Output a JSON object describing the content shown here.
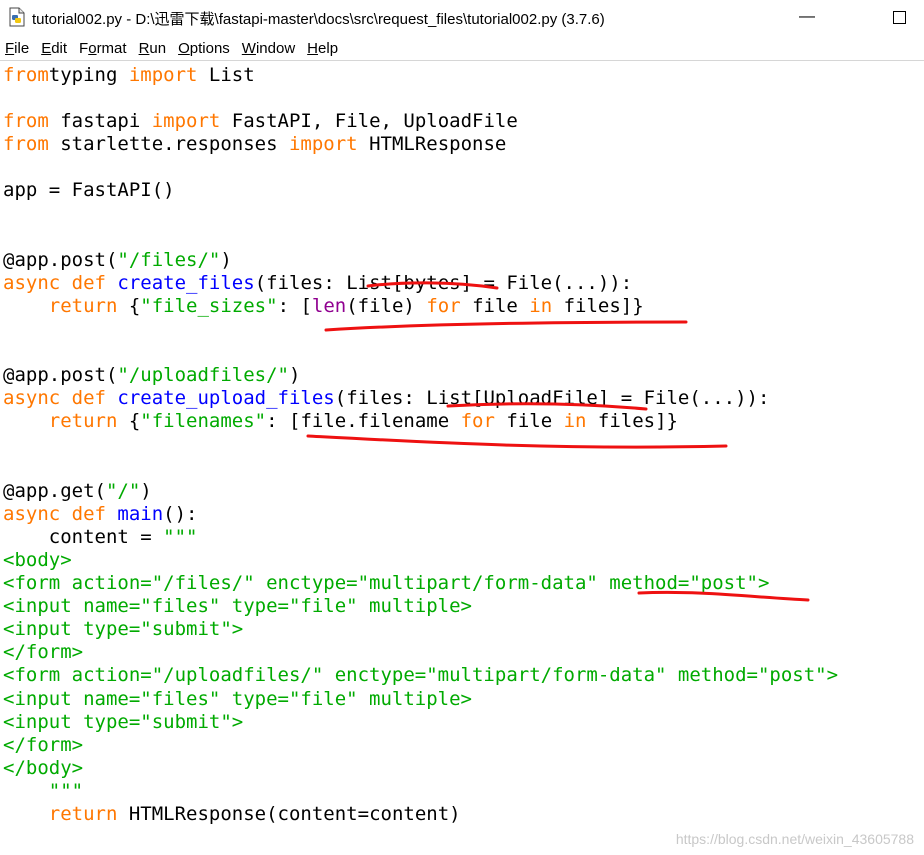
{
  "window": {
    "title": "tutorial002.py - D:\\迅雷下载\\fastapi-master\\docs\\src\\request_files\\tutorial002.py (3.7.6)",
    "minimize_glyph": "—",
    "maximize_glyph": "☐"
  },
  "menu": [
    {
      "mnemonic": "F",
      "rest": "ile"
    },
    {
      "mnemonic": "E",
      "rest": "dit"
    },
    {
      "mnemonic": "",
      "pre": "F",
      "mn": "o",
      "post": "rmat"
    },
    {
      "mnemonic": "R",
      "rest": "un"
    },
    {
      "mnemonic": "O",
      "rest": "ptions"
    },
    {
      "mnemonic": "W",
      "rest": "indow"
    },
    {
      "mnemonic": "H",
      "rest": "elp"
    }
  ],
  "colors": {
    "keyword": "#ff7700",
    "string": "#00aa00",
    "definition": "#0000ff",
    "builtin": "#900090",
    "annotation": "#ee0000"
  },
  "code_lines": [
    [
      [
        "kw",
        "from"
      ],
      [
        "",
        "typing "
      ],
      [
        "kw",
        "import"
      ],
      [
        "",
        " List"
      ]
    ],
    [],
    [
      [
        "kw",
        "from"
      ],
      [
        "",
        ""
      ],
      [
        "",
        " fastapi "
      ],
      [
        "kw",
        "import"
      ],
      [
        "",
        " FastAPI, File, UploadFile"
      ]
    ],
    [
      [
        "kw",
        "from"
      ],
      [
        "",
        " starlette.responses "
      ],
      [
        "kw",
        "import"
      ],
      [
        "",
        " HTMLResponse"
      ]
    ],
    [],
    [
      [
        "",
        "app = FastAPI()"
      ]
    ],
    [],
    [],
    [
      [
        "",
        "@app.post("
      ],
      [
        "str",
        "\"/files/\""
      ],
      [
        "",
        ")"
      ]
    ],
    [
      [
        "kw",
        "async def"
      ],
      [
        "",
        " "
      ],
      [
        "def",
        "create_files"
      ],
      [
        "",
        "(files: List[bytes] = File(...)):"
      ]
    ],
    [
      [
        "",
        "    "
      ],
      [
        "kw",
        "return"
      ],
      [
        "",
        " {"
      ],
      [
        "str",
        "\"file_sizes\""
      ],
      [
        "",
        ": ["
      ],
      [
        "bi",
        "len"
      ],
      [
        "",
        "(file) "
      ],
      [
        "kw",
        "for"
      ],
      [
        "",
        " file "
      ],
      [
        "kw",
        "in"
      ],
      [
        "",
        " files]}"
      ]
    ],
    [],
    [],
    [
      [
        "",
        "@app.post("
      ],
      [
        "str",
        "\"/uploadfiles/\""
      ],
      [
        "",
        ")"
      ]
    ],
    [
      [
        "kw",
        "async def"
      ],
      [
        "",
        " "
      ],
      [
        "def",
        "create_upload_files"
      ],
      [
        "",
        "(files: List[UploadFile] = File(...)):"
      ]
    ],
    [
      [
        "",
        "    "
      ],
      [
        "kw",
        "return"
      ],
      [
        "",
        " {"
      ],
      [
        "str",
        "\"filenames\""
      ],
      [
        "",
        ": [file.filename "
      ],
      [
        "kw",
        "for"
      ],
      [
        "",
        " file "
      ],
      [
        "kw",
        "in"
      ],
      [
        "",
        " files]}"
      ]
    ],
    [],
    [],
    [
      [
        "",
        "@app.get("
      ],
      [
        "str",
        "\"/\""
      ],
      [
        "",
        ")"
      ]
    ],
    [
      [
        "kw",
        "async def"
      ],
      [
        "",
        " "
      ],
      [
        "def",
        "main"
      ],
      [
        "",
        "():"
      ]
    ],
    [
      [
        "",
        "    content = "
      ],
      [
        "str",
        "\"\"\""
      ]
    ],
    [
      [
        "str",
        "<body>"
      ]
    ],
    [
      [
        "str",
        "<form action=\"/files/\" enctype=\"multipart/form-data\" method=\"post\">"
      ]
    ],
    [
      [
        "str",
        "<input name=\"files\" type=\"file\" multiple>"
      ]
    ],
    [
      [
        "str",
        "<input type=\"submit\">"
      ]
    ],
    [
      [
        "str",
        "</form>"
      ]
    ],
    [
      [
        "str",
        "<form action=\"/uploadfiles/\" enctype=\"multipart/form-data\" method=\"post\">"
      ]
    ],
    [
      [
        "str",
        "<input name=\"files\" type=\"file\" multiple>"
      ]
    ],
    [
      [
        "str",
        "<input type=\"submit\">"
      ]
    ],
    [
      [
        "str",
        "</form>"
      ]
    ],
    [
      [
        "str",
        "</body>"
      ]
    ],
    [
      [
        "str",
        "    \"\"\""
      ]
    ],
    [
      [
        "",
        "    "
      ],
      [
        "kw",
        "return"
      ],
      [
        "",
        " HTMLResponse(content=content)"
      ]
    ]
  ],
  "watermark": "https://blog.csdn.net/weixin_43605788"
}
